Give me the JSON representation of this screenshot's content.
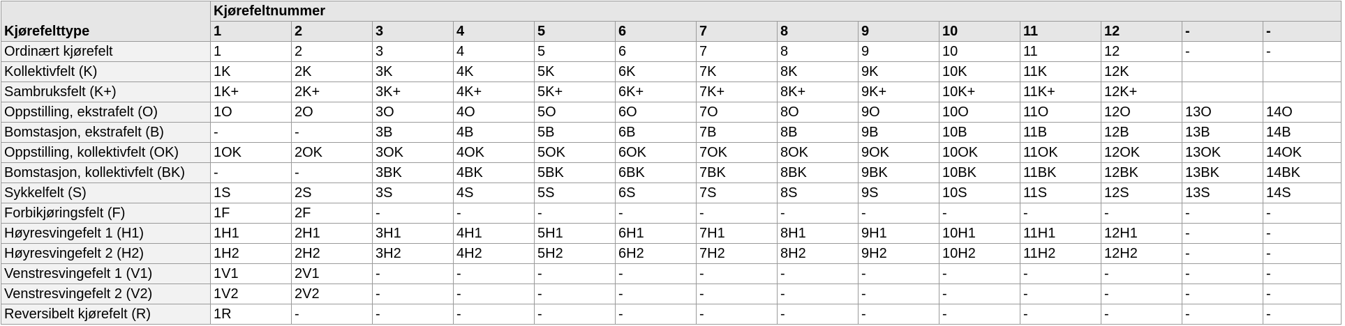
{
  "table": {
    "type_header": "Kjørefelttype",
    "group_header": "Kjørefeltnummer",
    "columns": [
      "1",
      "2",
      "3",
      "4",
      "5",
      "6",
      "7",
      "8",
      "9",
      "10",
      "11",
      "12",
      "-",
      "-"
    ],
    "rows": [
      {
        "label": "Ordinært kjørefelt",
        "cells": [
          "1",
          "2",
          "3",
          "4",
          "5",
          "6",
          "7",
          "8",
          "9",
          "10",
          "11",
          "12",
          "-",
          "-"
        ]
      },
      {
        "label": "Kollektivfelt (K)",
        "cells": [
          "1K",
          "2K",
          "3K",
          "4K",
          "5K",
          "6K",
          "7K",
          "8K",
          "9K",
          "10K",
          "11K",
          "12K",
          "",
          ""
        ]
      },
      {
        "label": "Sambruksfelt (K+)",
        "cells": [
          "1K+",
          "2K+",
          "3K+",
          "4K+",
          "5K+",
          "6K+",
          "7K+",
          "8K+",
          "9K+",
          "10K+",
          "11K+",
          "12K+",
          "",
          ""
        ]
      },
      {
        "label": "Oppstilling, ekstrafelt (O)",
        "cells": [
          "1O",
          "2O",
          "3O",
          "4O",
          "5O",
          "6O",
          "7O",
          "8O",
          "9O",
          "10O",
          "11O",
          "12O",
          "13O",
          "14O"
        ]
      },
      {
        "label": "Bomstasjon, ekstrafelt (B)",
        "cells": [
          "-",
          "-",
          "3B",
          "4B",
          "5B",
          "6B",
          "7B",
          "8B",
          "9B",
          "10B",
          "11B",
          "12B",
          "13B",
          "14B"
        ]
      },
      {
        "label": "Oppstilling, kollektivfelt (OK)",
        "cells": [
          "1OK",
          "2OK",
          "3OK",
          "4OK",
          "5OK",
          "6OK",
          "7OK",
          "8OK",
          "9OK",
          "10OK",
          "11OK",
          "12OK",
          "13OK",
          "14OK"
        ]
      },
      {
        "label": "Bomstasjon, kollektivfelt (BK)",
        "cells": [
          "-",
          "-",
          "3BK",
          "4BK",
          "5BK",
          "6BK",
          "7BK",
          "8BK",
          "9BK",
          "10BK",
          "11BK",
          "12BK",
          "13BK",
          "14BK"
        ]
      },
      {
        "label": "Sykkelfelt (S)",
        "cells": [
          "1S",
          "2S",
          "3S",
          "4S",
          "5S",
          "6S",
          "7S",
          "8S",
          "9S",
          "10S",
          "11S",
          "12S",
          "13S",
          "14S"
        ]
      },
      {
        "label": "Forbikjøringsfelt (F)",
        "cells": [
          "1F",
          "2F",
          "-",
          "-",
          "-",
          "-",
          "-",
          "-",
          "-",
          "-",
          "-",
          "-",
          "-",
          "-"
        ]
      },
      {
        "label": "Høyresvingefelt 1 (H1)",
        "cells": [
          "1H1",
          "2H1",
          "3H1",
          "4H1",
          "5H1",
          "6H1",
          "7H1",
          "8H1",
          "9H1",
          "10H1",
          "11H1",
          "12H1",
          "-",
          "-"
        ]
      },
      {
        "label": "Høyresvingefelt 2 (H2)",
        "cells": [
          "1H2",
          "2H2",
          "3H2",
          "4H2",
          "5H2",
          "6H2",
          "7H2",
          "8H2",
          "9H2",
          "10H2",
          "11H2",
          "12H2",
          "-",
          "-"
        ]
      },
      {
        "label": "Venstresvingefelt 1 (V1)",
        "cells": [
          "1V1",
          "2V1",
          "-",
          "-",
          "-",
          "-",
          "-",
          "-",
          "-",
          "-",
          "-",
          "-",
          "-",
          "-"
        ]
      },
      {
        "label": "Venstresvingefelt 2 (V2)",
        "cells": [
          "1V2",
          "2V2",
          "-",
          "-",
          "-",
          "-",
          "-",
          "-",
          "-",
          "-",
          "-",
          "-",
          "-",
          "-"
        ]
      },
      {
        "label": "Reversibelt kjørefelt (R)",
        "cells": [
          "1R",
          "-",
          "-",
          "-",
          "-",
          "-",
          "-",
          "-",
          "-",
          "-",
          "-",
          "-",
          "-",
          "-"
        ]
      }
    ]
  }
}
